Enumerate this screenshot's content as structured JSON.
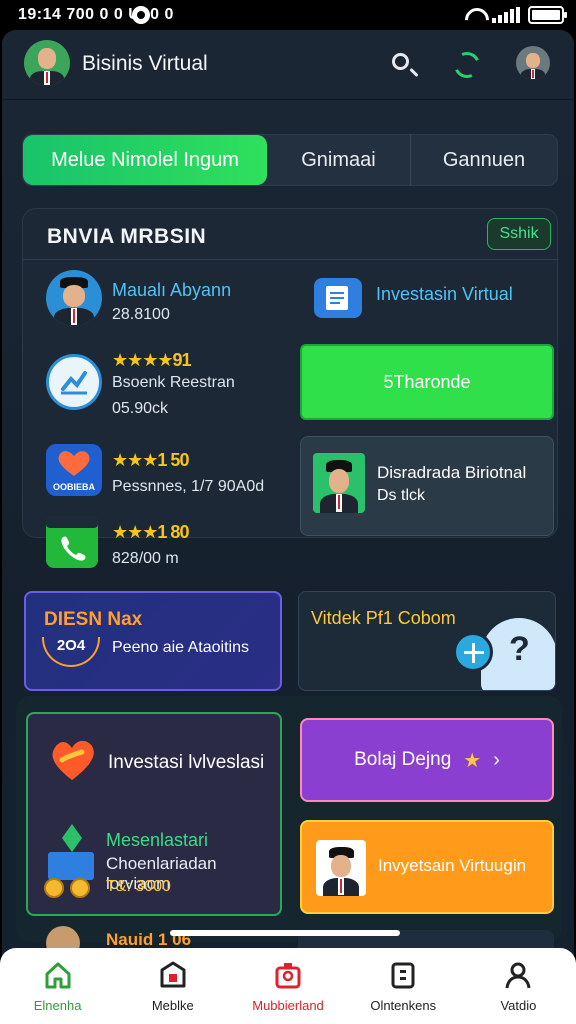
{
  "status_bar": {
    "time": "19:14 700 0 0 UI 0 0"
  },
  "header": {
    "title": "Bisinis Virtual"
  },
  "segments": [
    "Melue Nimolel Ingum",
    "Gnimaai",
    "Gannuen"
  ],
  "panel": {
    "title": "BNVIA MRBSIN",
    "badge": "Sshik",
    "rows": [
      {
        "title": "Maualı Abyann",
        "value": "28.8100"
      },
      {
        "rating": "★★★★",
        "rating_text": "91",
        "title": "Bsoenk Reestran",
        "value": "05.90ck"
      },
      {
        "rating": "★★★",
        "rating_text": "1 50",
        "title": "Pessnnes, 1/7 90A0d"
      },
      {
        "rating": "★★★",
        "rating_text": "1 80",
        "value": "828/00 m"
      }
    ],
    "app_icon_label": "OOBIEBA",
    "right": {
      "invest_label": "Investasin Virtual",
      "cta": "5Tharonde",
      "card_title": "Disradrada Biriotnal",
      "card_sub": "Ds tlck"
    }
  },
  "banners": {
    "left_title": "DIESN Nax",
    "left_year": "2O4",
    "left_sub": "Peeno aie Ataoitins",
    "right_title": "Vitdek Pf1 Cobom"
  },
  "cards": {
    "invest_title": "Investasi lvlveslasi",
    "promo_title": "Mesenlastari",
    "promo_sub": "Choenlariadan lorviaom",
    "promo_value": "T&: 3000",
    "learn_button": "Bolaj Dejng",
    "orange_button": "Invyetsain Virtuugin"
  },
  "peek_text": "Nauid 1 06",
  "nav": [
    {
      "label": "Elnenha",
      "icon": "home-icon"
    },
    {
      "label": "Meblke",
      "icon": "store-icon"
    },
    {
      "label": "Mubbierland",
      "icon": "gift-icon"
    },
    {
      "label": "Olntenkens",
      "icon": "clipboard-icon"
    },
    {
      "label": "Vatdio",
      "icon": "person-icon"
    }
  ],
  "colors": {
    "accent_green": "#2fe04a",
    "background": "#1b2735",
    "purple": "#8a3fd1",
    "orange": "#ff9a1a",
    "active_nav": "#2e9e3a",
    "nav_red": "#e0202e"
  }
}
